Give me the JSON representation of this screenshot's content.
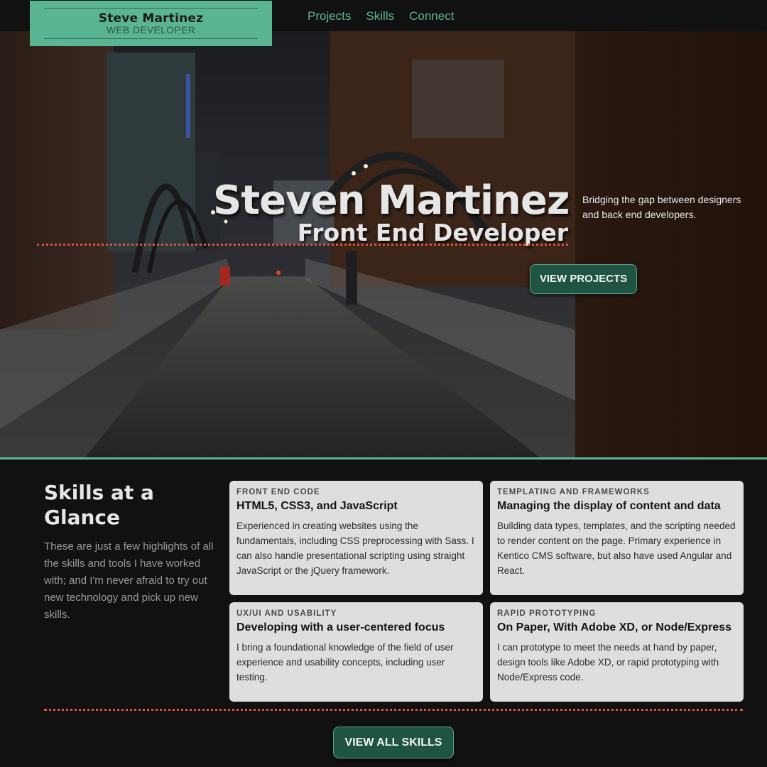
{
  "header": {
    "logo_name": "Steve Martinez",
    "logo_role": "WEB DEVELOPER",
    "nav": [
      "Projects",
      "Skills",
      "Connect"
    ]
  },
  "hero": {
    "title": "Steven Martinez",
    "subtitle": "Front End Developer",
    "tagline": "Bridging the gap between designers and back end developers.",
    "button": "VIEW PROJECTS"
  },
  "skills": {
    "title": "Skills at a Glance",
    "intro": "These are just a few highlights of all the skills and tools I have worked with; and I'm never afraid to try out new technology and pick up new skills.",
    "cards": [
      {
        "eyebrow": "FRONT END CODE",
        "heading": "HTML5, CSS3, and JavaScript",
        "body": "Experienced in creating websites using the fundamentals, including CSS preprocessing with Sass. I can also handle presentational scripting using straight JavaScript or the jQuery framework."
      },
      {
        "eyebrow": "TEMPLATING AND FRAMEWORKS",
        "heading": "Managing the display of content and data",
        "body": "Building data types, templates, and the scripting needed to render content on the page. Primary experience in Kentico CMS software, but also have used Angular and React."
      },
      {
        "eyebrow": "UX/UI AND USABILITY",
        "heading": "Developing with a user-centered focus",
        "body": "I bring a foundational knowledge of the field of user experience and usability concepts, including user testing."
      },
      {
        "eyebrow": "RAPID PROTOTYPING",
        "heading": "On Paper, With Adobe XD, or Node/Express",
        "body": "I can prototype to meet the needs at hand by paper, design tools like Adobe XD, or rapid prototyping with Node/Express code."
      }
    ],
    "button": "VIEW ALL SKILLS"
  },
  "colors": {
    "accent_green": "#5cb592",
    "button_green": "#1f5443",
    "dotted_red": "#d9563e",
    "background": "#111111",
    "card": "#dedede"
  }
}
